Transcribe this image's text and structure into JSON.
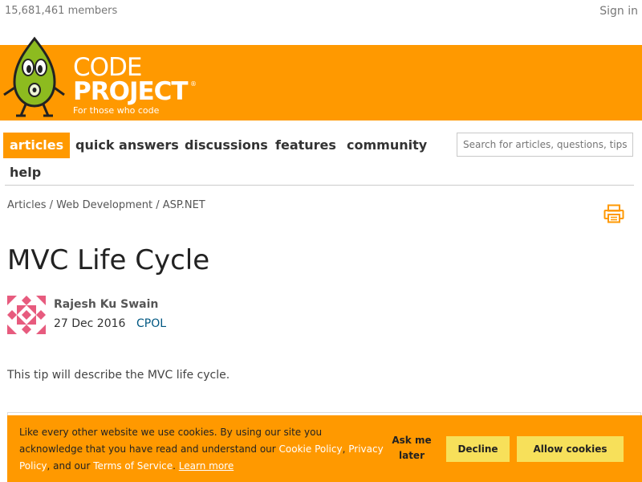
{
  "header": {
    "members_text": "15,681,461 members",
    "signin_label": "Sign in"
  },
  "logo": {
    "line1": "CODE",
    "line2": "PROJECT",
    "reg": "®",
    "tagline": "For those who code"
  },
  "nav": {
    "items": [
      {
        "label": "articles",
        "active": true
      },
      {
        "label": "quick answers"
      },
      {
        "label": "discussions"
      },
      {
        "label": "features"
      },
      {
        "label": "community"
      },
      {
        "label": "help"
      }
    ],
    "search_placeholder": "Search for articles, questions, tips"
  },
  "breadcrumb": "Articles / Web Development / ASP.NET",
  "article": {
    "title": "MVC Life Cycle",
    "author": "Rajesh Ku Swain",
    "date": "27 Dec 2016",
    "license": "CPOL",
    "summary": "This tip will describe the MVC life cycle."
  },
  "cookie_banner": {
    "text_1": "Like every other website we use cookies. By using our site you acknowledge that you have read and understand our ",
    "cookie_policy": "Cookie Policy",
    "sep_1": ", ",
    "privacy_policy": "Privacy Policy",
    "text_2": ", and our ",
    "terms": "Terms of Service",
    "sep_2": ". ",
    "learn_more": "Learn more",
    "ask_later": "Ask me later",
    "decline": "Decline",
    "allow": "Allow cookies"
  },
  "colors": {
    "brand_orange": "#ff9900",
    "button_yellow": "#f7e05a",
    "link_blue": "#005782"
  },
  "icons": [
    "mascot-logo-icon",
    "print-icon"
  ]
}
